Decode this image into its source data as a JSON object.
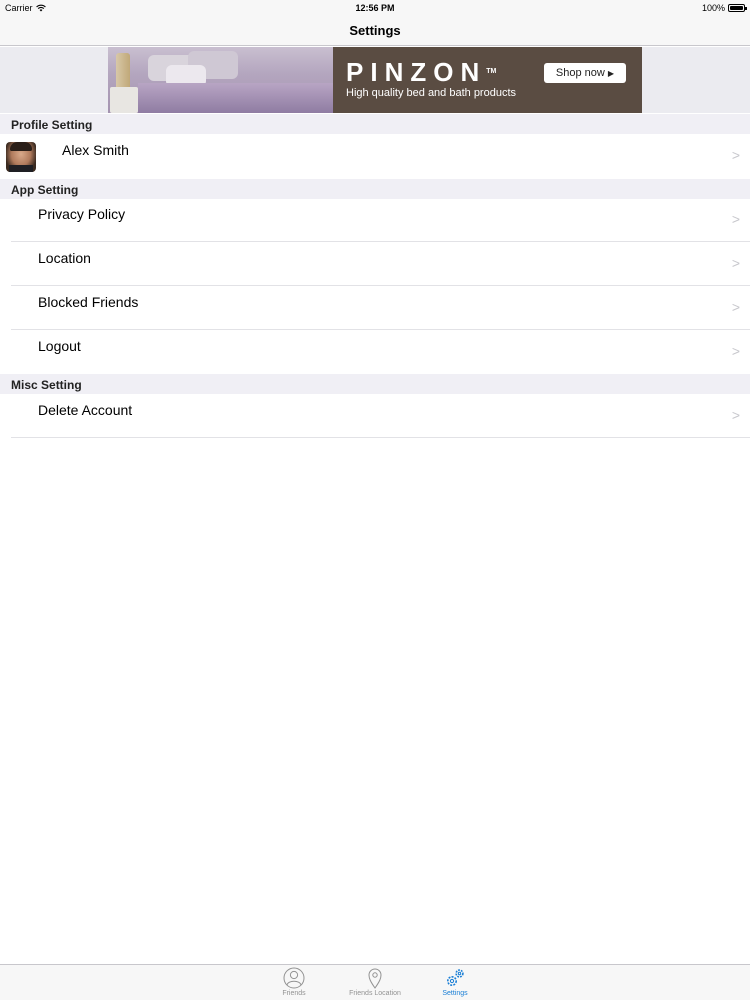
{
  "status_bar": {
    "carrier": "Carrier",
    "time": "12:56 PM",
    "battery": "100%",
    "battery_level": 1.0
  },
  "nav": {
    "title": "Settings"
  },
  "ad": {
    "brand": "PINZON",
    "trademark": "TM",
    "tagline": "High quality bed and bath products",
    "cta": "Shop now"
  },
  "sections": {
    "profile": {
      "header": "Profile Setting",
      "name": "Alex Smith"
    },
    "app": {
      "header": "App Setting",
      "items": [
        "Privacy Policy",
        "Location",
        "Blocked Friends",
        "Logout"
      ]
    },
    "misc": {
      "header": "Misc Setting",
      "items": [
        "Delete Account"
      ]
    }
  },
  "chevron": ">",
  "tabs": [
    {
      "label": "Friends",
      "icon": "person-icon",
      "active": false
    },
    {
      "label": "Friends Location",
      "icon": "location-pin-icon",
      "active": false
    },
    {
      "label": "Settings",
      "icon": "gears-icon",
      "active": true
    }
  ],
  "colors": {
    "accent": "#1a7fd6",
    "inactive_tab": "#929292",
    "ad_background": "#5a4c42"
  }
}
